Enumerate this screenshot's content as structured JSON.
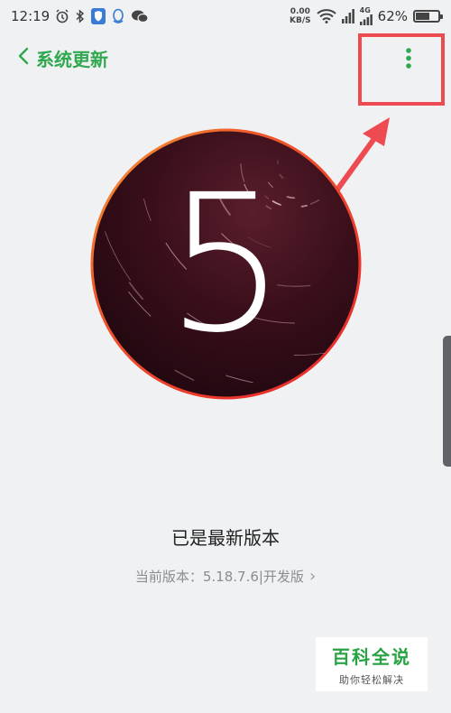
{
  "status_bar": {
    "time": "12:19",
    "net_speed_value": "0.00",
    "net_speed_unit": "KB/S",
    "signal_label": "4G",
    "battery_percent": "62%",
    "battery_level": 0.62,
    "icons": [
      "alarm-icon",
      "bluetooth-icon",
      "shield-icon",
      "qq-icon",
      "wechat-icon",
      "wifi-icon",
      "cell-signal-icon",
      "battery-icon"
    ]
  },
  "header": {
    "title": "系统更新",
    "back_icon": "chevron-left-icon",
    "more_icon": "more-vertical-icon"
  },
  "version_graphic": {
    "digit": "5"
  },
  "status": {
    "message": "已是最新版本",
    "current_version": "当前版本：5.18.7.6|开发版",
    "chevron": "›"
  },
  "watermark": {
    "title": "百科全说",
    "subtitle": "助你轻松解决"
  },
  "colors": {
    "accent_green": "#2fa84f",
    "annotation_red": "#ee4a52",
    "background": "#eff1f3"
  }
}
